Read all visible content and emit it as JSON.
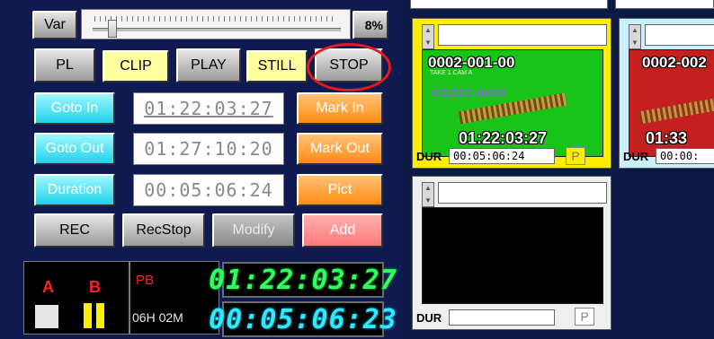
{
  "controls": {
    "var_label": "Var",
    "slider_percent_label": "8%",
    "slider_value_percent": 8,
    "mode_buttons": [
      "PL",
      "CLIP",
      "PLAY",
      "STILL",
      "STOP"
    ],
    "goto_in_label": "Goto In",
    "goto_out_label": "Goto Out",
    "duration_label": "Duration",
    "mark_in_label": "Mark In",
    "mark_out_label": "Mark Out",
    "pict_label": "Pict",
    "in_timecode": "01:22:03:27",
    "out_timecode": "01:27:10:20",
    "duration_timecode": "00:05:06:24",
    "rec_label": "REC",
    "recstop_label": "RecStop",
    "modify_label": "Modify",
    "add_label": "Add"
  },
  "status": {
    "a_label": "A",
    "b_label": "B",
    "pb_label": "PB",
    "remain": "06H 02M",
    "led_timecode": "01:22:03:27",
    "led_duration": "00:05:06:23"
  },
  "bins": [
    {
      "clip_id": "0002-001-00",
      "sub_text": "TAKE 1 CAM A",
      "logo_text": "VDZ01-0000",
      "timecode": "01:22:03:27",
      "dur_label": "DUR",
      "dur_value": "00:05:06:24",
      "p_label": "P"
    },
    {
      "clip_id": "0002-002",
      "timecode": "01:33",
      "dur_label": "DUR",
      "dur_value": "00:00:"
    },
    {
      "dur_label": "DUR",
      "dur_value": "",
      "p_label": "P"
    }
  ],
  "colors": {
    "panel_bg": "#0e1a50",
    "bin1_frame": "#ffee00",
    "bin1_thumb": "#18c418",
    "bin2_thumb": "#c42020",
    "highlight_ring": "#e21b1b",
    "led_green": "#30ff60",
    "led_cyan": "#30e8ff"
  }
}
